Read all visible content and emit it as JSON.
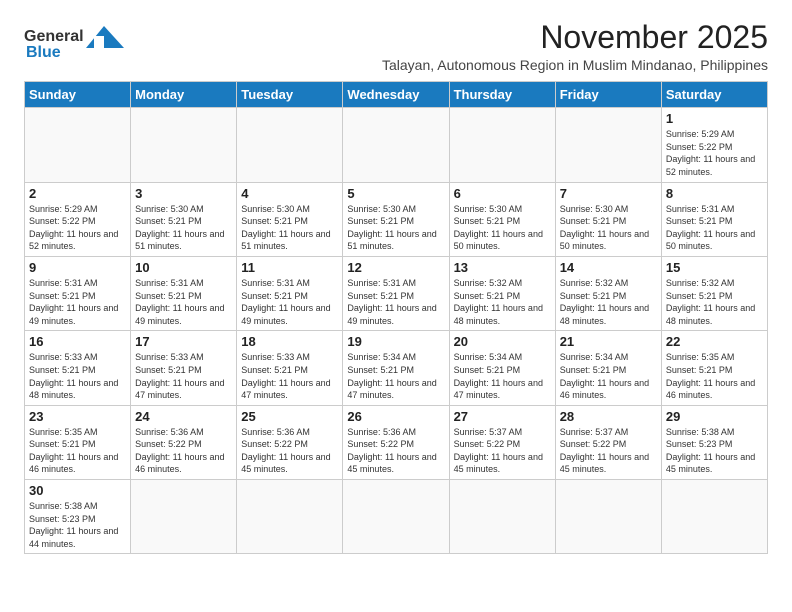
{
  "header": {
    "logo_general": "General",
    "logo_blue": "Blue",
    "month_title": "November 2025",
    "location": "Talayan, Autonomous Region in Muslim Mindanao, Philippines"
  },
  "weekdays": [
    "Sunday",
    "Monday",
    "Tuesday",
    "Wednesday",
    "Thursday",
    "Friday",
    "Saturday"
  ],
  "weeks": [
    [
      {
        "day": "",
        "info": ""
      },
      {
        "day": "",
        "info": ""
      },
      {
        "day": "",
        "info": ""
      },
      {
        "day": "",
        "info": ""
      },
      {
        "day": "",
        "info": ""
      },
      {
        "day": "",
        "info": ""
      },
      {
        "day": "1",
        "info": "Sunrise: 5:29 AM\nSunset: 5:22 PM\nDaylight: 11 hours\nand 52 minutes."
      }
    ],
    [
      {
        "day": "2",
        "info": "Sunrise: 5:29 AM\nSunset: 5:22 PM\nDaylight: 11 hours\nand 52 minutes."
      },
      {
        "day": "3",
        "info": "Sunrise: 5:30 AM\nSunset: 5:21 PM\nDaylight: 11 hours\nand 51 minutes."
      },
      {
        "day": "4",
        "info": "Sunrise: 5:30 AM\nSunset: 5:21 PM\nDaylight: 11 hours\nand 51 minutes."
      },
      {
        "day": "5",
        "info": "Sunrise: 5:30 AM\nSunset: 5:21 PM\nDaylight: 11 hours\nand 51 minutes."
      },
      {
        "day": "6",
        "info": "Sunrise: 5:30 AM\nSunset: 5:21 PM\nDaylight: 11 hours\nand 50 minutes."
      },
      {
        "day": "7",
        "info": "Sunrise: 5:30 AM\nSunset: 5:21 PM\nDaylight: 11 hours\nand 50 minutes."
      },
      {
        "day": "8",
        "info": "Sunrise: 5:31 AM\nSunset: 5:21 PM\nDaylight: 11 hours\nand 50 minutes."
      }
    ],
    [
      {
        "day": "9",
        "info": "Sunrise: 5:31 AM\nSunset: 5:21 PM\nDaylight: 11 hours\nand 49 minutes."
      },
      {
        "day": "10",
        "info": "Sunrise: 5:31 AM\nSunset: 5:21 PM\nDaylight: 11 hours\nand 49 minutes."
      },
      {
        "day": "11",
        "info": "Sunrise: 5:31 AM\nSunset: 5:21 PM\nDaylight: 11 hours\nand 49 minutes."
      },
      {
        "day": "12",
        "info": "Sunrise: 5:31 AM\nSunset: 5:21 PM\nDaylight: 11 hours\nand 49 minutes."
      },
      {
        "day": "13",
        "info": "Sunrise: 5:32 AM\nSunset: 5:21 PM\nDaylight: 11 hours\nand 48 minutes."
      },
      {
        "day": "14",
        "info": "Sunrise: 5:32 AM\nSunset: 5:21 PM\nDaylight: 11 hours\nand 48 minutes."
      },
      {
        "day": "15",
        "info": "Sunrise: 5:32 AM\nSunset: 5:21 PM\nDaylight: 11 hours\nand 48 minutes."
      }
    ],
    [
      {
        "day": "16",
        "info": "Sunrise: 5:33 AM\nSunset: 5:21 PM\nDaylight: 11 hours\nand 48 minutes."
      },
      {
        "day": "17",
        "info": "Sunrise: 5:33 AM\nSunset: 5:21 PM\nDaylight: 11 hours\nand 47 minutes."
      },
      {
        "day": "18",
        "info": "Sunrise: 5:33 AM\nSunset: 5:21 PM\nDaylight: 11 hours\nand 47 minutes."
      },
      {
        "day": "19",
        "info": "Sunrise: 5:34 AM\nSunset: 5:21 PM\nDaylight: 11 hours\nand 47 minutes."
      },
      {
        "day": "20",
        "info": "Sunrise: 5:34 AM\nSunset: 5:21 PM\nDaylight: 11 hours\nand 47 minutes."
      },
      {
        "day": "21",
        "info": "Sunrise: 5:34 AM\nSunset: 5:21 PM\nDaylight: 11 hours\nand 46 minutes."
      },
      {
        "day": "22",
        "info": "Sunrise: 5:35 AM\nSunset: 5:21 PM\nDaylight: 11 hours\nand 46 minutes."
      }
    ],
    [
      {
        "day": "23",
        "info": "Sunrise: 5:35 AM\nSunset: 5:21 PM\nDaylight: 11 hours\nand 46 minutes."
      },
      {
        "day": "24",
        "info": "Sunrise: 5:36 AM\nSunset: 5:22 PM\nDaylight: 11 hours\nand 46 minutes."
      },
      {
        "day": "25",
        "info": "Sunrise: 5:36 AM\nSunset: 5:22 PM\nDaylight: 11 hours\nand 45 minutes."
      },
      {
        "day": "26",
        "info": "Sunrise: 5:36 AM\nSunset: 5:22 PM\nDaylight: 11 hours\nand 45 minutes."
      },
      {
        "day": "27",
        "info": "Sunrise: 5:37 AM\nSunset: 5:22 PM\nDaylight: 11 hours\nand 45 minutes."
      },
      {
        "day": "28",
        "info": "Sunrise: 5:37 AM\nSunset: 5:22 PM\nDaylight: 11 hours\nand 45 minutes."
      },
      {
        "day": "29",
        "info": "Sunrise: 5:38 AM\nSunset: 5:23 PM\nDaylight: 11 hours\nand 45 minutes."
      }
    ],
    [
      {
        "day": "30",
        "info": "Sunrise: 5:38 AM\nSunset: 5:23 PM\nDaylight: 11 hours\nand 44 minutes."
      },
      {
        "day": "",
        "info": ""
      },
      {
        "day": "",
        "info": ""
      },
      {
        "day": "",
        "info": ""
      },
      {
        "day": "",
        "info": ""
      },
      {
        "day": "",
        "info": ""
      },
      {
        "day": "",
        "info": ""
      }
    ]
  ]
}
